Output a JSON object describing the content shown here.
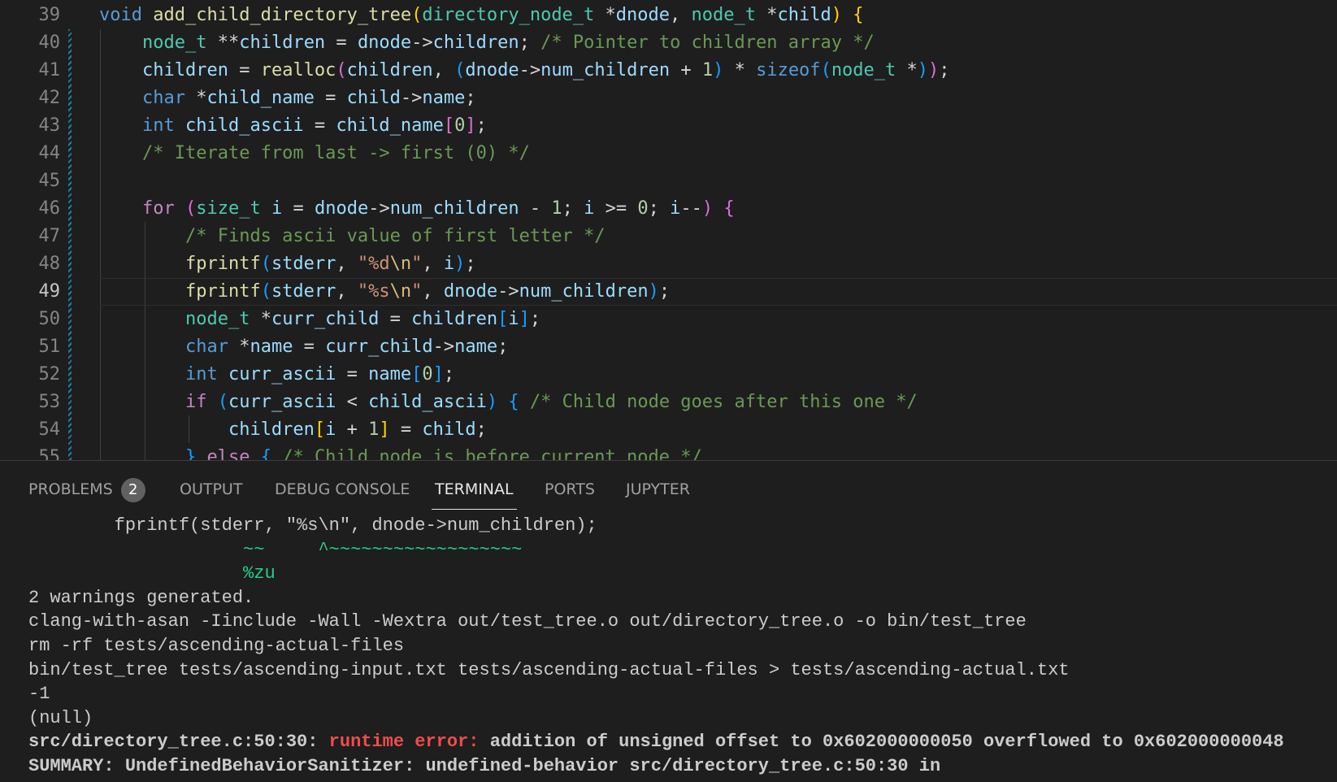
{
  "editor": {
    "active_line": "49",
    "lines": [
      {
        "n": "39",
        "tokens": [
          [
            "kw",
            "void"
          ],
          [
            "op",
            " "
          ],
          [
            "fn",
            "add_child_directory_tree"
          ],
          [
            "b1",
            "("
          ],
          [
            "ty",
            "directory_node_t"
          ],
          [
            "op",
            " *"
          ],
          [
            "vr",
            "dnode"
          ],
          [
            "op",
            ", "
          ],
          [
            "ty",
            "node_t"
          ],
          [
            "op",
            " *"
          ],
          [
            "vr",
            "child"
          ],
          [
            "b1",
            ")"
          ],
          [
            "op",
            " "
          ],
          [
            "b1",
            "{"
          ]
        ]
      },
      {
        "n": "40",
        "tokens": [
          [
            "op",
            "    "
          ],
          [
            "ty",
            "node_t"
          ],
          [
            "op",
            " **"
          ],
          [
            "vr",
            "children"
          ],
          [
            "op",
            " = "
          ],
          [
            "vr",
            "dnode"
          ],
          [
            "op",
            "->"
          ],
          [
            "vr",
            "children"
          ],
          [
            "op",
            "; "
          ],
          [
            "cm",
            "/* Pointer to children array */"
          ]
        ]
      },
      {
        "n": "41",
        "tokens": [
          [
            "op",
            "    "
          ],
          [
            "vr",
            "children"
          ],
          [
            "op",
            " = "
          ],
          [
            "fn",
            "realloc"
          ],
          [
            "b2",
            "("
          ],
          [
            "vr",
            "children"
          ],
          [
            "op",
            ", "
          ],
          [
            "b3",
            "("
          ],
          [
            "vr",
            "dnode"
          ],
          [
            "op",
            "->"
          ],
          [
            "vr",
            "num_children"
          ],
          [
            "op",
            " + "
          ],
          [
            "num",
            "1"
          ],
          [
            "b3",
            ")"
          ],
          [
            "op",
            " * "
          ],
          [
            "kw",
            "sizeof"
          ],
          [
            "b3",
            "("
          ],
          [
            "ty",
            "node_t"
          ],
          [
            "op",
            " *"
          ],
          [
            "b3",
            ")"
          ],
          [
            "b2",
            ")"
          ],
          [
            "op",
            ";"
          ]
        ]
      },
      {
        "n": "42",
        "tokens": [
          [
            "op",
            "    "
          ],
          [
            "kw",
            "char"
          ],
          [
            "op",
            " *"
          ],
          [
            "vr",
            "child_name"
          ],
          [
            "op",
            " = "
          ],
          [
            "vr",
            "child"
          ],
          [
            "op",
            "->"
          ],
          [
            "vr",
            "name"
          ],
          [
            "op",
            ";"
          ]
        ]
      },
      {
        "n": "43",
        "tokens": [
          [
            "op",
            "    "
          ],
          [
            "kw",
            "int"
          ],
          [
            "op",
            " "
          ],
          [
            "vr",
            "child_ascii"
          ],
          [
            "op",
            " = "
          ],
          [
            "vr",
            "child_name"
          ],
          [
            "b2",
            "["
          ],
          [
            "num",
            "0"
          ],
          [
            "b2",
            "]"
          ],
          [
            "op",
            ";"
          ]
        ]
      },
      {
        "n": "44",
        "tokens": [
          [
            "op",
            "    "
          ],
          [
            "cm",
            "/* Iterate from last -> first (0) */"
          ]
        ]
      },
      {
        "n": "45",
        "tokens": []
      },
      {
        "n": "46",
        "tokens": [
          [
            "op",
            "    "
          ],
          [
            "ctl",
            "for"
          ],
          [
            "op",
            " "
          ],
          [
            "b2",
            "("
          ],
          [
            "ty",
            "size_t"
          ],
          [
            "op",
            " "
          ],
          [
            "vr",
            "i"
          ],
          [
            "op",
            " = "
          ],
          [
            "vr",
            "dnode"
          ],
          [
            "op",
            "->"
          ],
          [
            "vr",
            "num_children"
          ],
          [
            "op",
            " - "
          ],
          [
            "num",
            "1"
          ],
          [
            "op",
            "; "
          ],
          [
            "vr",
            "i"
          ],
          [
            "op",
            " >= "
          ],
          [
            "num",
            "0"
          ],
          [
            "op",
            "; "
          ],
          [
            "vr",
            "i"
          ],
          [
            "op",
            "--"
          ],
          [
            "b2",
            ")"
          ],
          [
            "op",
            " "
          ],
          [
            "b2",
            "{"
          ]
        ]
      },
      {
        "n": "47",
        "tokens": [
          [
            "op",
            "        "
          ],
          [
            "cm",
            "/* Finds ascii value of first letter */"
          ]
        ]
      },
      {
        "n": "48",
        "tokens": [
          [
            "op",
            "        "
          ],
          [
            "fn",
            "fprintf"
          ],
          [
            "b3",
            "("
          ],
          [
            "vr",
            "stderr"
          ],
          [
            "op",
            ", "
          ],
          [
            "str",
            "\"%d"
          ],
          [
            "esc",
            "\\n"
          ],
          [
            "str",
            "\""
          ],
          [
            "op",
            ", "
          ],
          [
            "vr",
            "i"
          ],
          [
            "b3",
            ")"
          ],
          [
            "op",
            ";"
          ]
        ]
      },
      {
        "n": "49",
        "tokens": [
          [
            "op",
            "        "
          ],
          [
            "fn",
            "fprintf"
          ],
          [
            "b3",
            "("
          ],
          [
            "vr",
            "stderr"
          ],
          [
            "op",
            ", "
          ],
          [
            "str",
            "\"%s"
          ],
          [
            "esc",
            "\\n"
          ],
          [
            "str",
            "\""
          ],
          [
            "op",
            ", "
          ],
          [
            "vr",
            "dnode"
          ],
          [
            "op",
            "->"
          ],
          [
            "vr",
            "num_children"
          ],
          [
            "b3",
            ")"
          ],
          [
            "op",
            ";"
          ]
        ]
      },
      {
        "n": "50",
        "tokens": [
          [
            "op",
            "        "
          ],
          [
            "ty",
            "node_t"
          ],
          [
            "op",
            " *"
          ],
          [
            "vr",
            "curr_child"
          ],
          [
            "op",
            " = "
          ],
          [
            "vr",
            "children"
          ],
          [
            "b3",
            "["
          ],
          [
            "vr",
            "i"
          ],
          [
            "b3",
            "]"
          ],
          [
            "op",
            ";"
          ]
        ]
      },
      {
        "n": "51",
        "tokens": [
          [
            "op",
            "        "
          ],
          [
            "kw",
            "char"
          ],
          [
            "op",
            " *"
          ],
          [
            "vr",
            "name"
          ],
          [
            "op",
            " = "
          ],
          [
            "vr",
            "curr_child"
          ],
          [
            "op",
            "->"
          ],
          [
            "vr",
            "name"
          ],
          [
            "op",
            ";"
          ]
        ]
      },
      {
        "n": "52",
        "tokens": [
          [
            "op",
            "        "
          ],
          [
            "kw",
            "int"
          ],
          [
            "op",
            " "
          ],
          [
            "vr",
            "curr_ascii"
          ],
          [
            "op",
            " = "
          ],
          [
            "vr",
            "name"
          ],
          [
            "b3",
            "["
          ],
          [
            "num",
            "0"
          ],
          [
            "b3",
            "]"
          ],
          [
            "op",
            ";"
          ]
        ]
      },
      {
        "n": "53",
        "tokens": [
          [
            "op",
            "        "
          ],
          [
            "ctl",
            "if"
          ],
          [
            "op",
            " "
          ],
          [
            "b3",
            "("
          ],
          [
            "vr",
            "curr_ascii"
          ],
          [
            "op",
            " < "
          ],
          [
            "vr",
            "child_ascii"
          ],
          [
            "b3",
            ")"
          ],
          [
            "op",
            " "
          ],
          [
            "b3",
            "{"
          ],
          [
            "op",
            " "
          ],
          [
            "cm",
            "/* Child node goes after this one */"
          ]
        ]
      },
      {
        "n": "54",
        "tokens": [
          [
            "op",
            "            "
          ],
          [
            "vr",
            "children"
          ],
          [
            "b1",
            "["
          ],
          [
            "vr",
            "i"
          ],
          [
            "op",
            " + "
          ],
          [
            "num",
            "1"
          ],
          [
            "b1",
            "]"
          ],
          [
            "op",
            " = "
          ],
          [
            "vr",
            "child"
          ],
          [
            "op",
            ";"
          ]
        ]
      },
      {
        "n": "55",
        "tokens": [
          [
            "op",
            "        "
          ],
          [
            "b3",
            "}"
          ],
          [
            "op",
            " "
          ],
          [
            "ctl",
            "else"
          ],
          [
            "op",
            " "
          ],
          [
            "b3",
            "{"
          ],
          [
            "op",
            " "
          ],
          [
            "cm",
            "/* Child node is before current node */"
          ]
        ]
      }
    ]
  },
  "panel": {
    "tabs": [
      {
        "id": "problems",
        "label": "PROBLEMS",
        "badge": "2"
      },
      {
        "id": "output",
        "label": "OUTPUT"
      },
      {
        "id": "debug",
        "label": "DEBUG CONSOLE"
      },
      {
        "id": "terminal",
        "label": "TERMINAL",
        "active": true
      },
      {
        "id": "ports",
        "label": "PORTS"
      },
      {
        "id": "jupyter",
        "label": "JUPYTER"
      }
    ],
    "terminal": {
      "lines": [
        [
          [
            "",
            "        fprintf(stderr, \"%s\\n\", dnode->num_children);"
          ]
        ],
        [
          [
            "green",
            "                    ~~     ^~~~~~~~~~~~~~~~~~~"
          ]
        ],
        [
          [
            "green",
            "                    %zu"
          ]
        ],
        [
          [
            "",
            "2 warnings generated."
          ]
        ],
        [
          [
            "",
            "clang-with-asan -Iinclude -Wall -Wextra out/test_tree.o out/directory_tree.o -o bin/test_tree"
          ]
        ],
        [
          [
            "",
            "rm -rf tests/ascending-actual-files"
          ]
        ],
        [
          [
            "",
            "bin/test_tree tests/ascending-input.txt tests/ascending-actual-files > tests/ascending-actual.txt"
          ]
        ],
        [
          [
            "",
            "-1"
          ]
        ],
        [
          [
            "",
            "(null)"
          ]
        ],
        [
          [
            "bold",
            "src/directory_tree.c:50:30: "
          ],
          [
            "bold red",
            "runtime error: "
          ],
          [
            "bold",
            "addition of unsigned offset to 0x602000000050 overflowed to 0x602000000048"
          ]
        ],
        [
          [
            "bold",
            "SUMMARY: UndefinedBehaviorSanitizer: undefined-behavior src/directory_tree.c:50:30 in"
          ]
        ]
      ]
    }
  }
}
